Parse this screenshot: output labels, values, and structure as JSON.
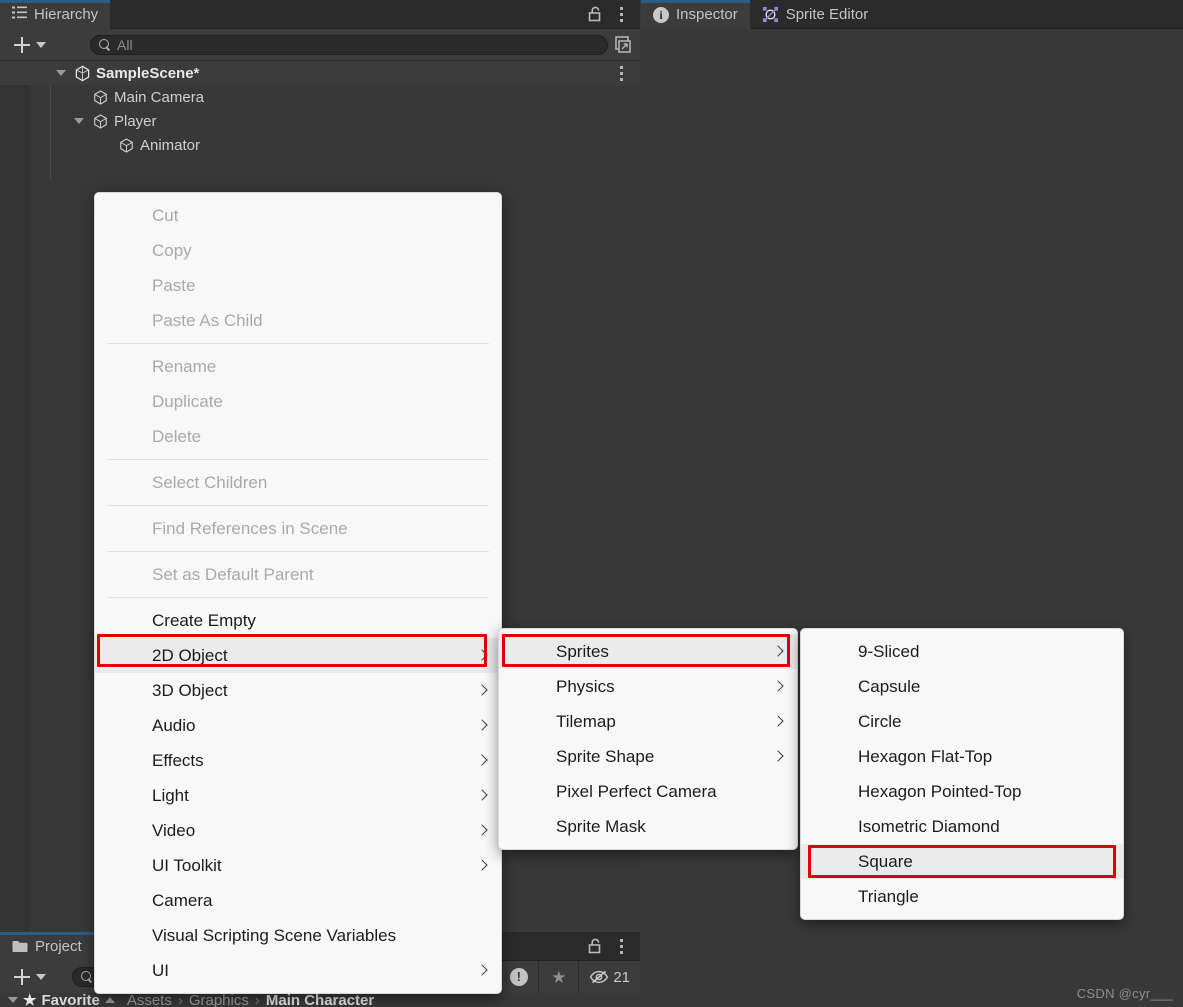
{
  "app": "Unity Editor",
  "hierarchy": {
    "tab_label": "Hierarchy",
    "tab_icon": "hierarchy-list-icon",
    "lock_icon": "lock-open-icon",
    "menu_icon": "kebab-menu-icon",
    "add_button_label": "+",
    "search": {
      "placeholder": "All",
      "value": "",
      "icon": "search-icon"
    },
    "expand_icon": "expand-panel-icon",
    "tree": [
      {
        "label": "SampleScene*",
        "icon": "unity-scene-icon",
        "depth": 0,
        "expanded": true,
        "selected": true,
        "has_kebab": true
      },
      {
        "label": "Main Camera",
        "icon": "gameobject-cube-icon",
        "depth": 1,
        "expanded": null,
        "selected": false,
        "has_kebab": false
      },
      {
        "label": "Player",
        "icon": "gameobject-cube-icon",
        "depth": 1,
        "expanded": true,
        "selected": false,
        "has_kebab": false
      },
      {
        "label": "Animator",
        "icon": "gameobject-cube-icon",
        "depth": 2,
        "expanded": null,
        "selected": false,
        "has_kebab": false
      }
    ]
  },
  "inspector": {
    "tabs": [
      {
        "label": "Inspector",
        "icon": "info-circle-icon",
        "active": true
      },
      {
        "label": "Sprite Editor",
        "icon": "sprite-editor-icon",
        "active": false
      }
    ]
  },
  "project": {
    "tab_label": "Project",
    "tab_icon": "folder-icon",
    "lock_icon": "lock-open-icon",
    "menu_icon": "kebab-menu-icon",
    "add_button_label": "+",
    "search": {
      "placeholder": "",
      "value": "",
      "icon": "search-icon"
    },
    "favorites_label": "Favorite",
    "breadcrumb": [
      "Assets",
      "Graphics",
      "Main Character"
    ],
    "status": [
      {
        "name": "console-warning",
        "icon": "exclamation-circle-icon",
        "value": ""
      },
      {
        "name": "favorites",
        "icon": "star-icon",
        "value": ""
      },
      {
        "name": "hidden-objects-count",
        "icon": "eye-off-icon",
        "value": "21"
      }
    ]
  },
  "context_menu": {
    "items": [
      {
        "label": "Cut",
        "disabled": true,
        "submenu": false,
        "highlight": false
      },
      {
        "label": "Copy",
        "disabled": true,
        "submenu": false,
        "highlight": false
      },
      {
        "label": "Paste",
        "disabled": true,
        "submenu": false,
        "highlight": false
      },
      {
        "label": "Paste As Child",
        "disabled": true,
        "submenu": false,
        "highlight": false
      },
      {
        "separator": true
      },
      {
        "label": "Rename",
        "disabled": true,
        "submenu": false,
        "highlight": false
      },
      {
        "label": "Duplicate",
        "disabled": true,
        "submenu": false,
        "highlight": false
      },
      {
        "label": "Delete",
        "disabled": true,
        "submenu": false,
        "highlight": false
      },
      {
        "separator": true
      },
      {
        "label": "Select Children",
        "disabled": true,
        "submenu": false,
        "highlight": false
      },
      {
        "separator": true
      },
      {
        "label": "Find References in Scene",
        "disabled": true,
        "submenu": false,
        "highlight": false
      },
      {
        "separator": true
      },
      {
        "label": "Set as Default Parent",
        "disabled": true,
        "submenu": false,
        "highlight": false
      },
      {
        "separator": true
      },
      {
        "label": "Create Empty",
        "disabled": false,
        "submenu": false,
        "highlight": false
      },
      {
        "label": "2D Object",
        "disabled": false,
        "submenu": true,
        "highlight": true
      },
      {
        "label": "3D Object",
        "disabled": false,
        "submenu": true,
        "highlight": false
      },
      {
        "label": "Audio",
        "disabled": false,
        "submenu": true,
        "highlight": false
      },
      {
        "label": "Effects",
        "disabled": false,
        "submenu": true,
        "highlight": false
      },
      {
        "label": "Light",
        "disabled": false,
        "submenu": true,
        "highlight": false
      },
      {
        "label": "Video",
        "disabled": false,
        "submenu": true,
        "highlight": false
      },
      {
        "label": "UI Toolkit",
        "disabled": false,
        "submenu": true,
        "highlight": false
      },
      {
        "label": "Camera",
        "disabled": false,
        "submenu": false,
        "highlight": false
      },
      {
        "label": "Visual Scripting Scene Variables",
        "disabled": false,
        "submenu": false,
        "highlight": false
      },
      {
        "label": "UI",
        "disabled": false,
        "submenu": true,
        "highlight": false
      }
    ]
  },
  "submenu_2d": {
    "items": [
      {
        "label": "Sprites",
        "submenu": true,
        "highlight": true
      },
      {
        "label": "Physics",
        "submenu": true,
        "highlight": false
      },
      {
        "label": "Tilemap",
        "submenu": true,
        "highlight": false
      },
      {
        "label": "Sprite Shape",
        "submenu": true,
        "highlight": false
      },
      {
        "label": "Pixel Perfect Camera",
        "submenu": false,
        "highlight": false
      },
      {
        "label": "Sprite Mask",
        "submenu": false,
        "highlight": false
      }
    ]
  },
  "submenu_sprites": {
    "items": [
      {
        "label": "9-Sliced",
        "submenu": false,
        "highlight": false
      },
      {
        "label": "Capsule",
        "submenu": false,
        "highlight": false
      },
      {
        "label": "Circle",
        "submenu": false,
        "highlight": false
      },
      {
        "label": "Hexagon Flat-Top",
        "submenu": false,
        "highlight": false
      },
      {
        "label": "Hexagon Pointed-Top",
        "submenu": false,
        "highlight": false
      },
      {
        "label": "Isometric Diamond",
        "submenu": false,
        "highlight": false
      },
      {
        "label": "Square",
        "submenu": false,
        "highlight": true
      },
      {
        "label": "Triangle",
        "submenu": false,
        "highlight": false
      }
    ]
  },
  "watermark": "CSDN @cyr___",
  "colors": {
    "panel_bg": "#393939",
    "tabstrip_bg": "#2b2b2b",
    "active_tab_bg": "#3c3c3c",
    "active_tab_accent": "#2c5d87",
    "menu_bg": "#f8f8f8",
    "menu_highlight": "#ebebeb",
    "menu_text": "#1c1c1c",
    "menu_text_disabled": "#a9a9a9",
    "highlight_box": "#e00000"
  }
}
